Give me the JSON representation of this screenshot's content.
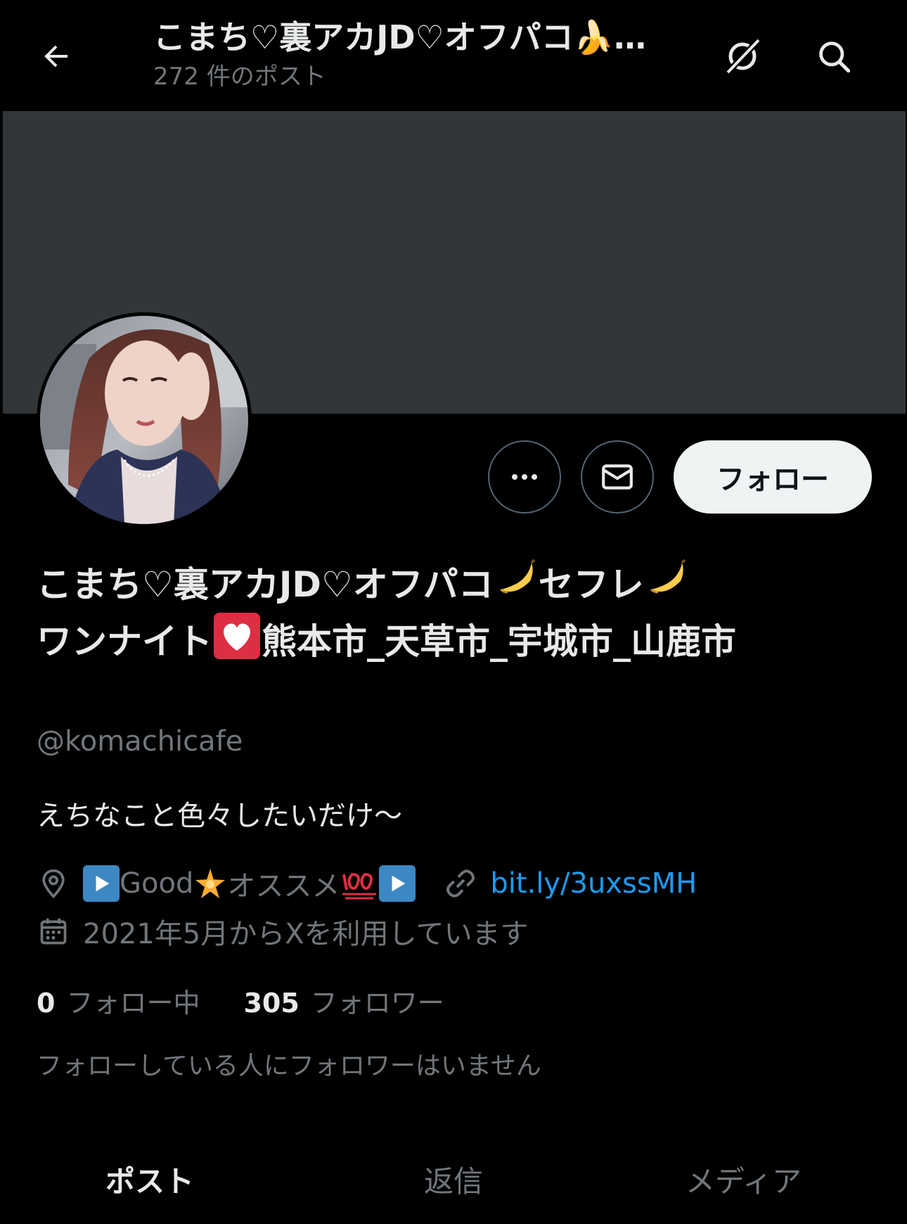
{
  "header": {
    "title": "こまち♡裏アカJD♡オフパコ🍌…",
    "post_count": "272 件のポスト"
  },
  "icons": {
    "back": "arrow-left-icon",
    "grok": "grok-icon",
    "search": "search-icon",
    "more": "more-horizontal-icon",
    "mail": "envelope-icon",
    "location": "location-pin-icon",
    "link": "link-icon",
    "calendar": "calendar-icon"
  },
  "profile": {
    "name_part1": "こまち♡裏アカJD♡オフパコ",
    "name_part2": "セフレ",
    "name_part3": "ワンナイト",
    "name_part4": "熊本市_天草市_宇城市_山鹿市",
    "handle": "@komachicafe",
    "bio": "えちなこと色々したいだけ〜",
    "location_a": "Good",
    "location_b": "オススメ",
    "link": "bit.ly/3uxssMH",
    "joined": "2021年5月からXを利用しています",
    "following_count": "0",
    "following_label": "フォロー中",
    "followers_count": "305",
    "followers_label": "フォロワー",
    "followers_note": "フォローしている人にフォロワーはいません"
  },
  "actions": {
    "follow_label": "フォロー"
  },
  "tabs": [
    {
      "label": "ポスト",
      "active": true
    },
    {
      "label": "返信",
      "active": false
    },
    {
      "label": "メディア",
      "active": false
    }
  ],
  "colors": {
    "background": "#000000",
    "banner": "#333639",
    "link": "#1d9bf0",
    "muted": "#71767b",
    "text": "#e7e9ea"
  }
}
